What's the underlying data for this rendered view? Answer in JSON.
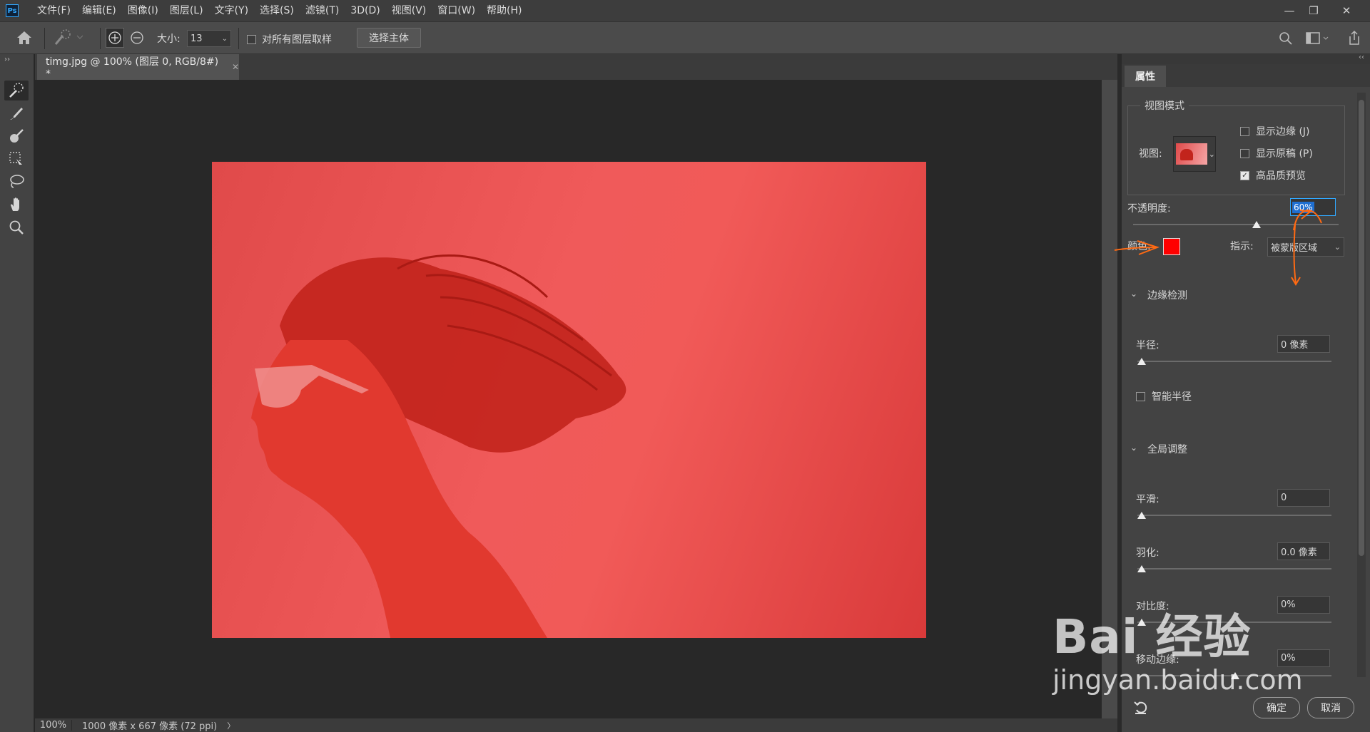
{
  "app": {
    "logo": "Ps"
  },
  "menu": [
    "文件(F)",
    "编辑(E)",
    "图像(I)",
    "图层(L)",
    "文字(Y)",
    "选择(S)",
    "滤镜(T)",
    "3D(D)",
    "视图(V)",
    "窗口(W)",
    "帮助(H)"
  ],
  "window_controls": {
    "minimize": "—",
    "restore": "❐",
    "close": "✕"
  },
  "options": {
    "size_label": "大小:",
    "size_value": "13",
    "sample_all_layers": "对所有图层取样",
    "select_subject": "选择主体"
  },
  "document": {
    "tab_title": "timg.jpg @ 100% (图层 0, RGB/8#) *",
    "zoom": "100%",
    "info": "1000 像素 x 667 像素 (72 ppi)",
    "info_arrow": "〉"
  },
  "panel": {
    "tab": "属性",
    "view_mode": {
      "title": "视图模式",
      "view_label": "视图:",
      "show_edge": "显示边缘 (J)",
      "show_original": "显示原稿 (P)",
      "hq_preview": "高品质预览",
      "show_edge_checked": false,
      "show_original_checked": false,
      "hq_preview_checked": true
    },
    "opacity_label": "不透明度:",
    "opacity_value": "60%",
    "opacity_percent": 60,
    "color_label": "颜色:",
    "color_hex": "#ff0000",
    "indicate_label": "指示:",
    "indicate_value": "被蒙版区域",
    "edge_detection": {
      "title": "边缘检测",
      "radius_label": "半径:",
      "radius_value": "0 像素",
      "smart_radius": "智能半径"
    },
    "global_refine": {
      "title": "全局调整",
      "smooth_label": "平滑:",
      "smooth_value": "0",
      "feather_label": "羽化:",
      "feather_value": "0.0 像素",
      "contrast_label": "对比度:",
      "contrast_value": "0%",
      "shift_edge_label": "移动边缘:",
      "shift_edge_value": "0%"
    },
    "ok": "确定",
    "cancel": "取消"
  },
  "watermark": {
    "brand": "Bai 经验",
    "url": "jingyan.baidu.com"
  },
  "colors": {
    "accent": "#31a8ff",
    "mask": "#ff0000",
    "overlay": "#f05a5a"
  }
}
